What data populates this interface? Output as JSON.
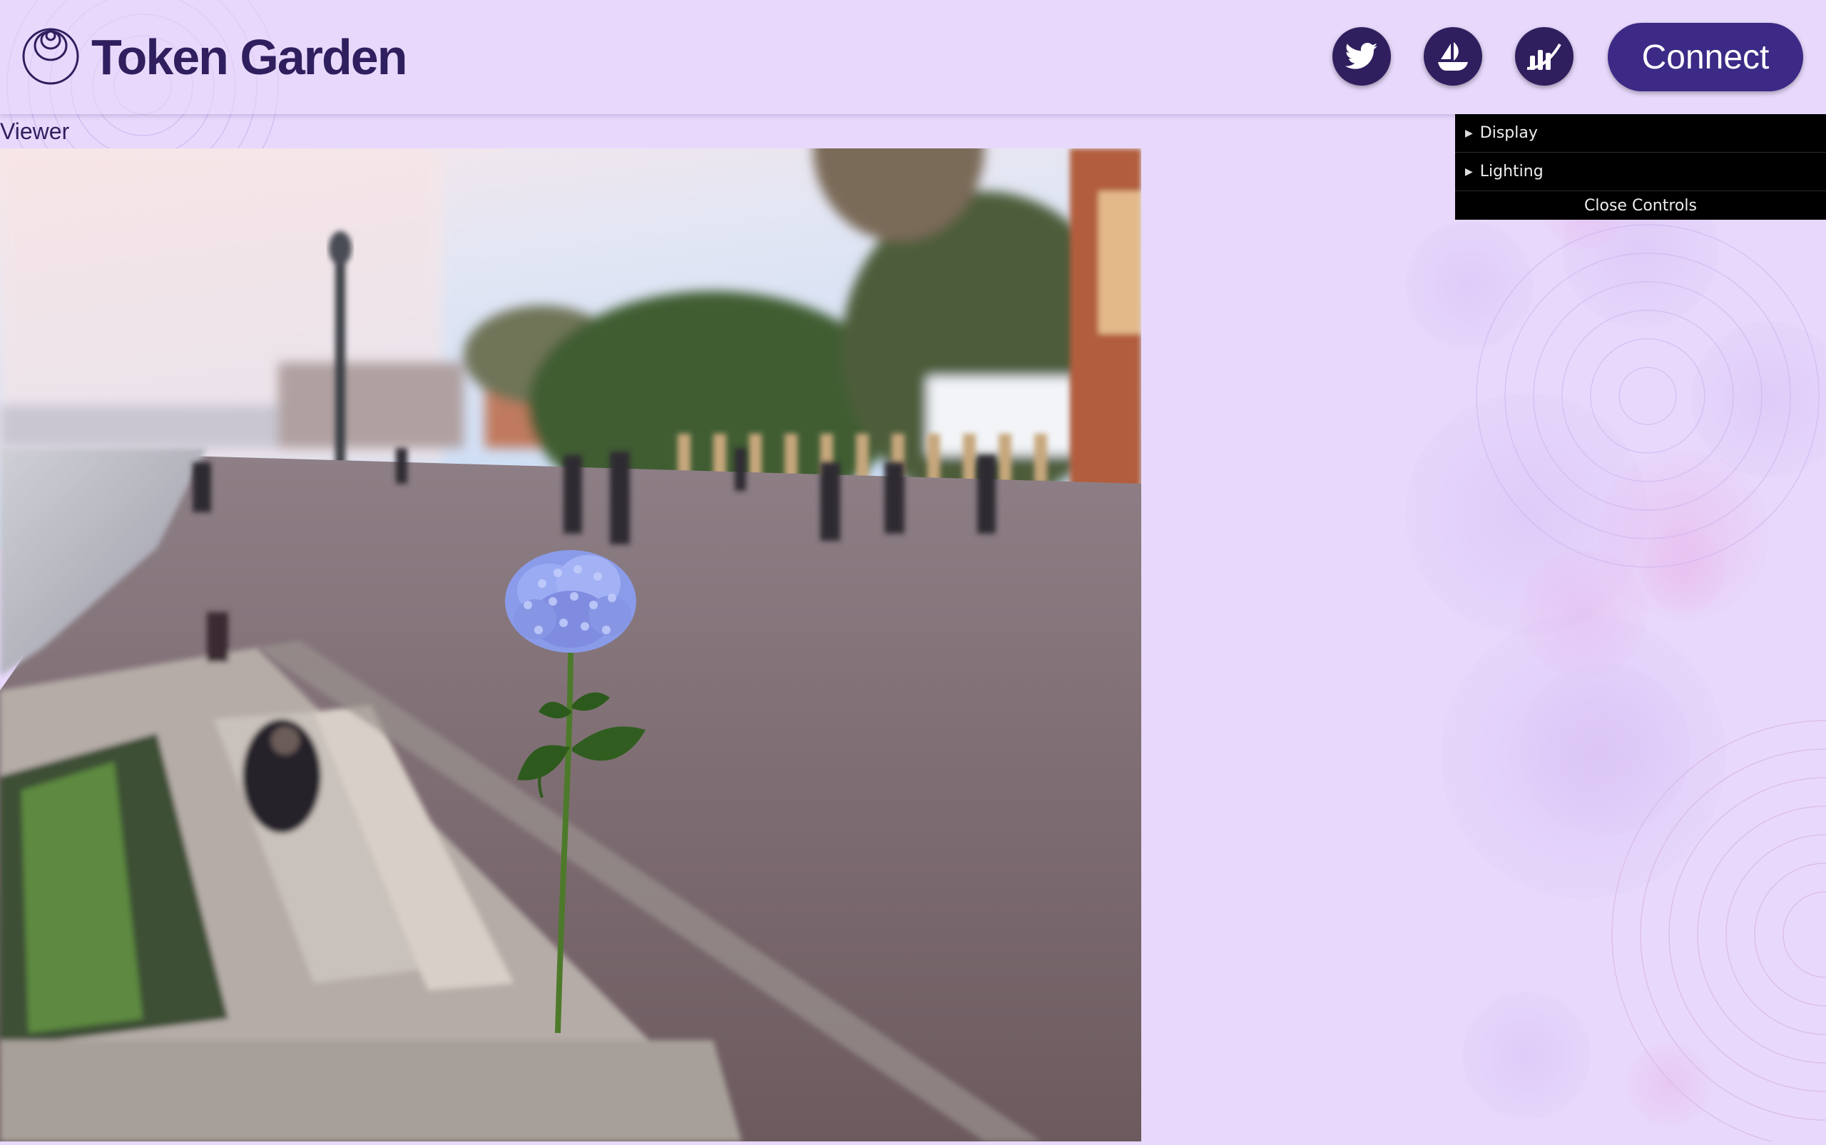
{
  "app": {
    "brand": "Token Garden",
    "logo_icon": "token-garden-logo-icon"
  },
  "header": {
    "social": [
      {
        "icon": "twitter-icon"
      },
      {
        "icon": "opensea-icon"
      },
      {
        "icon": "chart-icon"
      }
    ],
    "connect_label": "Connect"
  },
  "viewer": {
    "label": "Viewer",
    "scene_icon": "hydrangea-flower-icon"
  },
  "controls": {
    "folders": [
      {
        "label": "Display",
        "icon": "triangle-right-icon"
      },
      {
        "label": "Lighting",
        "icon": "triangle-right-icon"
      }
    ],
    "close_label": "Close Controls"
  },
  "colors": {
    "background": "#e8d9fc",
    "brand_text": "#2f1f5e",
    "button": "#3d2a86",
    "panel": "#000000"
  }
}
